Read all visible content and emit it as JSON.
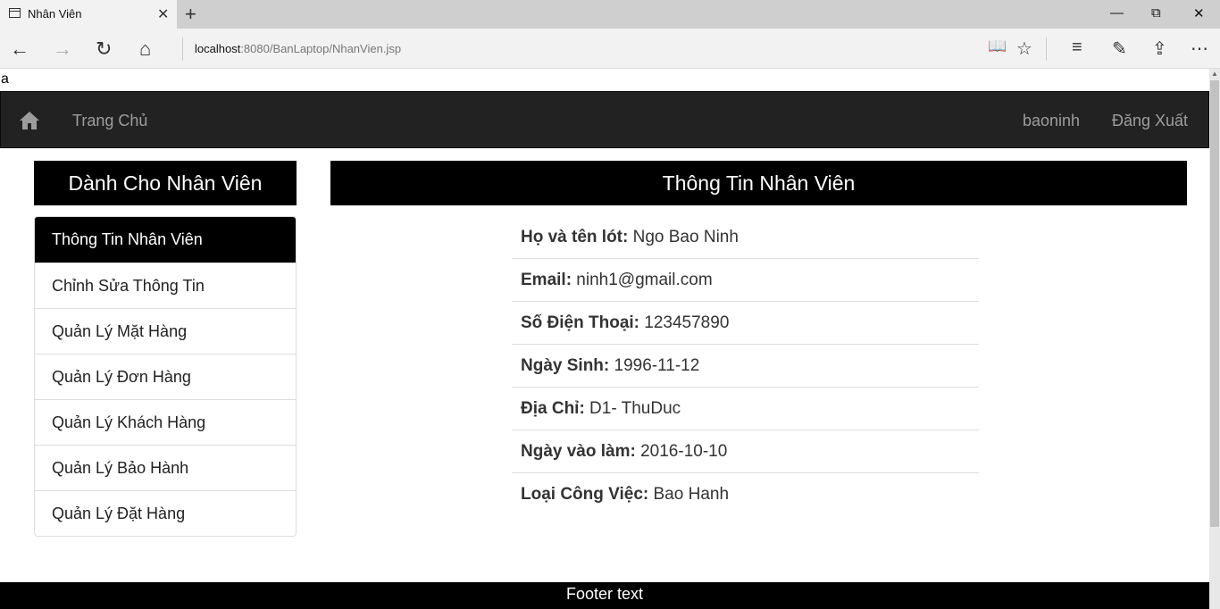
{
  "browser": {
    "tab_title": "Nhân Viên",
    "tab_close": "✕",
    "new_tab": "+",
    "url_host": "localhost",
    "url_rest": ":8080/BanLaptop/NhanVien.jsp",
    "minimize": "—",
    "maximize": "⧉",
    "close": "✕",
    "back": "←",
    "forward": "→",
    "refresh": "↻",
    "home": "⌂",
    "reading_view": "📖",
    "favorite": "☆",
    "hub": "≡",
    "notes": "✎",
    "share": "⇪",
    "more": "⋯"
  },
  "page": {
    "stray_text": "a",
    "navbar": {
      "home_label": "Trang Chủ",
      "username": "baoninh",
      "logout": "Đăng Xuất"
    },
    "sidebar": {
      "heading": "Dành Cho Nhân Viên",
      "items": [
        {
          "label": "Thông Tin Nhân Viên"
        },
        {
          "label": "Chỉnh Sửa Thông Tin"
        },
        {
          "label": "Quản Lý Mặt Hàng"
        },
        {
          "label": "Quản Lý Đơn Hàng"
        },
        {
          "label": "Quản Lý Khách Hàng"
        },
        {
          "label": "Quản Lý Bảo Hành"
        },
        {
          "label": "Quản Lý Đặt Hàng"
        }
      ]
    },
    "main": {
      "heading": "Thông Tin Nhân Viên",
      "rows": [
        {
          "label": "Họ và tên lót:",
          "value": " Ngo Bao Ninh"
        },
        {
          "label": "Email:",
          "value": " ninh1@gmail.com"
        },
        {
          "label": "Số Điện Thoại:",
          "value": " 123457890"
        },
        {
          "label": "Ngày Sinh:",
          "value": " 1996-11-12"
        },
        {
          "label": "Địa Chỉ:",
          "value": " D1- ThuDuc"
        },
        {
          "label": "Ngày vào làm:",
          "value": " 2016-10-10"
        },
        {
          "label": "Loại Công Việc:",
          "value": " Bao Hanh"
        }
      ]
    },
    "footer": "Footer text"
  }
}
